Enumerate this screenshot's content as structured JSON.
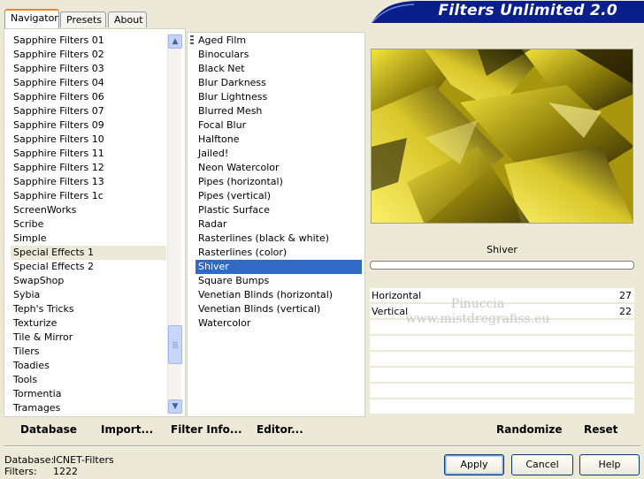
{
  "title": "Filters Unlimited 2.0",
  "tabs": [
    {
      "label": "Navigator"
    },
    {
      "label": "Presets"
    },
    {
      "label": "About"
    }
  ],
  "categories": [
    "Sapphire Filters 01",
    "Sapphire Filters 02",
    "Sapphire Filters 03",
    "Sapphire Filters 04",
    "Sapphire Filters 06",
    "Sapphire Filters 07",
    "Sapphire Filters 09",
    "Sapphire Filters 10",
    "Sapphire Filters 11",
    "Sapphire Filters 12",
    "Sapphire Filters 13",
    "Sapphire Filters 1c",
    "ScreenWorks",
    "Scribe",
    "Simple",
    "Special Effects 1",
    "Special Effects 2",
    "SwapShop",
    "Sybia",
    "Teph's Tricks",
    "Texturize",
    "Tile & Mirror",
    "Tilers",
    "Toadies",
    "Tools",
    "Tormentia",
    "Tramages"
  ],
  "selected_category": "Special Effects 1",
  "filters": [
    "Aged Film",
    "Binoculars",
    "Black Net",
    "Blur Darkness",
    "Blur Lightness",
    "Blurred Mesh",
    "Focal Blur",
    "Halftone",
    "Jailed!",
    "Neon Watercolor",
    "Pipes (horizontal)",
    "Pipes (vertical)",
    "Plastic Surface",
    "Radar",
    "Rasterlines (black & white)",
    "Rasterlines (color)",
    "Shiver",
    "Square Bumps",
    "Venetian Blinds (horizontal)",
    "Venetian Blinds (vertical)",
    "Watercolor"
  ],
  "selected_filter": "Shiver",
  "filter_name": "Shiver",
  "parameters": [
    {
      "label": "Horizontal",
      "value": "27"
    },
    {
      "label": "Vertical",
      "value": "22"
    }
  ],
  "watermark": {
    "line1": "Pinuccia",
    "line2": "www.mistdregrafiss.eu"
  },
  "bottom_buttons": {
    "database": "Database",
    "import": "Import...",
    "filter_info": "Filter Info...",
    "editor": "Editor...",
    "randomize": "Randomize",
    "reset": "Reset"
  },
  "status": {
    "database_label": "Database:",
    "database_value": "ICNET-Filters",
    "filters_label": "Filters:",
    "filters_value": "1222"
  },
  "dialog_buttons": {
    "apply": "Apply",
    "cancel": "Cancel",
    "help": "Help"
  },
  "colors": {
    "accent": "#0a1e8c",
    "selection": "#316ac5",
    "preview_base": "#8a7d0e"
  }
}
